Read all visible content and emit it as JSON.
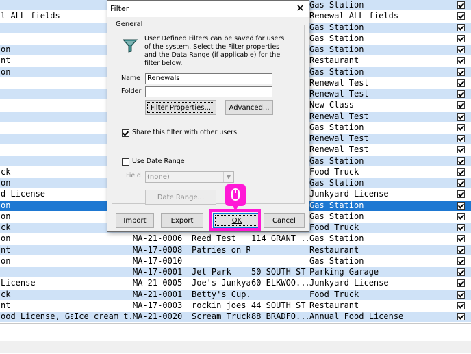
{
  "grid_rows": [
    {
      "c0": "",
      "c1": "",
      "c2": "",
      "c3": "",
      "c4": "",
      "c5": "Gas Station",
      "style": "alt"
    },
    {
      "c0": "l ALL fields",
      "c1": "",
      "c2": "",
      "c3": "",
      "c4": "",
      "c5": "Renewal ALL fields",
      "style": "white"
    },
    {
      "c0": "",
      "c1": "",
      "c2": "",
      "c3": "",
      "c4": "",
      "c5": "Gas Station",
      "style": "alt"
    },
    {
      "c0": "",
      "c1": "",
      "c2": "",
      "c3": "",
      "c4": "",
      "c5": "Gas Station",
      "style": "white"
    },
    {
      "c0": "on",
      "c1": "",
      "c2": "",
      "c3": "",
      "c4": "",
      "c5": "Gas Station",
      "style": "alt"
    },
    {
      "c0": "nt",
      "c1": "",
      "c2": "",
      "c3": "",
      "c4": "",
      "c5": "Restaurant",
      "style": "white"
    },
    {
      "c0": "on",
      "c1": "",
      "c2": "",
      "c3": "",
      "c4": "",
      "c5": "Gas Station",
      "style": "alt"
    },
    {
      "c0": "",
      "c1": "",
      "c2": "",
      "c3": "",
      "c4": "",
      "c5": "Renewal Test",
      "style": "white"
    },
    {
      "c0": "",
      "c1": "",
      "c2": "",
      "c3": "",
      "c4": "",
      "c5": "Renewal Test",
      "style": "alt"
    },
    {
      "c0": "",
      "c1": "",
      "c2": "",
      "c3": "",
      "c4": "",
      "c5": "New Class",
      "style": "white"
    },
    {
      "c0": "",
      "c1": "",
      "c2": "",
      "c3": "",
      "c4": "",
      "c5": "Renewal Test",
      "style": "alt"
    },
    {
      "c0": "",
      "c1": "",
      "c2": "",
      "c3": "",
      "c4": "",
      "c5": "Gas Station",
      "style": "white"
    },
    {
      "c0": "",
      "c1": "",
      "c2": "",
      "c3": "",
      "c4": "",
      "c5": "Renewal Test",
      "style": "alt"
    },
    {
      "c0": "",
      "c1": "",
      "c2": "",
      "c3": "",
      "c4": "",
      "c5": "Renewal Test",
      "style": "white"
    },
    {
      "c0": "",
      "c1": "",
      "c2": "",
      "c3": "",
      "c4": "",
      "c5": "Gas Station",
      "style": "alt"
    },
    {
      "c0": "ck",
      "c1": "",
      "c2": "",
      "c3": "",
      "c4": "",
      "c5": "Food Truck",
      "style": "white"
    },
    {
      "c0": "on",
      "c1": "",
      "c2": "",
      "c3": "",
      "c4": "",
      "c5": "Gas Station",
      "style": "alt"
    },
    {
      "c0": "d License",
      "c1": "",
      "c2": "",
      "c3": "",
      "c4": "",
      "c5": "Junkyard License",
      "style": "white"
    },
    {
      "c0": "on",
      "c1": "",
      "c2": "",
      "c3": "",
      "c4": "",
      "c5": "Gas Station",
      "style": "sel"
    },
    {
      "c0": "on",
      "c1": "",
      "c2": "",
      "c3": "",
      "c4": "",
      "c5": "Gas Station",
      "style": "white"
    },
    {
      "c0": "ck",
      "c1": "",
      "c2": "",
      "c3": "",
      "c4": "",
      "c5": "Food Truck",
      "style": "alt"
    },
    {
      "c0": "on",
      "c1": "",
      "c2": "MA-21-0006",
      "c3": "Reed Test",
      "c4": "114 GRANT ...",
      "c5": "Gas Station",
      "style": "white"
    },
    {
      "c0": "nt",
      "c1": "",
      "c2": "MA-17-0008",
      "c3": "Patries on R...",
      "c4": "",
      "c5": "Restaurant",
      "style": "alt"
    },
    {
      "c0": "on",
      "c1": "",
      "c2": "MA-17-0010",
      "c3": "",
      "c4": "",
      "c5": "Gas Station",
      "style": "white"
    },
    {
      "c0": "",
      "c1": "",
      "c2": "MA-17-0001",
      "c3": "Jet Park",
      "c4": "50 SOUTH ST",
      "c5": "Parking Garage",
      "style": "alt"
    },
    {
      "c0": " License",
      "c1": "",
      "c2": "MA-21-0005",
      "c3": "Joe's Junkyard",
      "c4": "60 ELKWOO...",
      "c5": "Junkyard License",
      "style": "white"
    },
    {
      "c0": "ck",
      "c1": "",
      "c2": "MA-21-0001",
      "c3": "Betty's Cup...",
      "c4": "",
      "c5": "Food Truck",
      "style": "alt"
    },
    {
      "c0": "nt",
      "c1": "",
      "c2": "MA-17-0003",
      "c3": "rockin joes",
      "c4": "44 SOUTH ST",
      "c5": "Restaurant",
      "style": "white"
    },
    {
      "c0": "ood License, Gas...",
      "c1": "Ice cream t...",
      "c2": "MA-21-0020",
      "c3": "Scream Truck",
      "c4": "88 BRADFO...",
      "c5": "Annual Food License",
      "style": "alt"
    }
  ],
  "dialog": {
    "title": "Filter",
    "close_glyph": "✕",
    "group_label": "General",
    "description": "User Defined Filters can be saved for users of the system. Select the Filter properties and the Data Range (if applicable) for the filter below.",
    "name_label": "Name",
    "name_value": "Renewals",
    "folder_label": "Folder",
    "folder_value": "",
    "filter_properties_button": "Filter Properties...",
    "advanced_button": "Advanced...",
    "share_checkbox_label": "Share this filter with other users",
    "share_checked": true,
    "use_date_range_label": "Use Date Range",
    "use_date_range_checked": false,
    "field_label": "Field",
    "field_value": "(none)",
    "date_range_button": "Date Range...",
    "import_button": "Import",
    "export_button": "Export",
    "ok_button": "OK",
    "cancel_button": "Cancel"
  },
  "colors": {
    "row_alt": "#cfe2f7",
    "row_selected": "#1e78d2",
    "highlight": "#ff19d6"
  }
}
